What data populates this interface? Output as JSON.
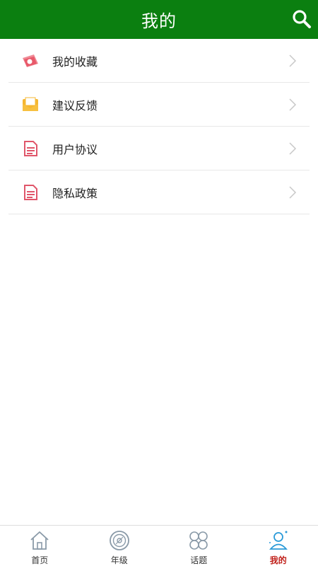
{
  "header": {
    "title": "我的",
    "search_icon": "search-icon"
  },
  "menu": {
    "items": [
      {
        "label": "我的收藏",
        "icon": "favorites-icon",
        "icon_color": "#e8596a"
      },
      {
        "label": "建议反馈",
        "icon": "mail-icon",
        "icon_color": "#f5b731"
      },
      {
        "label": "用户协议",
        "icon": "document-icon",
        "icon_color": "#e0566a"
      },
      {
        "label": "隐私政策",
        "icon": "document-icon",
        "icon_color": "#e0566a"
      }
    ]
  },
  "tabbar": {
    "tabs": [
      {
        "label": "首页",
        "icon": "home-icon"
      },
      {
        "label": "年级",
        "icon": "disc-icon"
      },
      {
        "label": "话题",
        "icon": "grid-icon"
      },
      {
        "label": "我的",
        "icon": "user-icon",
        "active": true
      }
    ]
  },
  "colors": {
    "header_bg": "#0b7f10",
    "active_tab": "#c0201a",
    "tab_icon": "#8a9aa8",
    "active_icon": "#2a9ad8"
  }
}
